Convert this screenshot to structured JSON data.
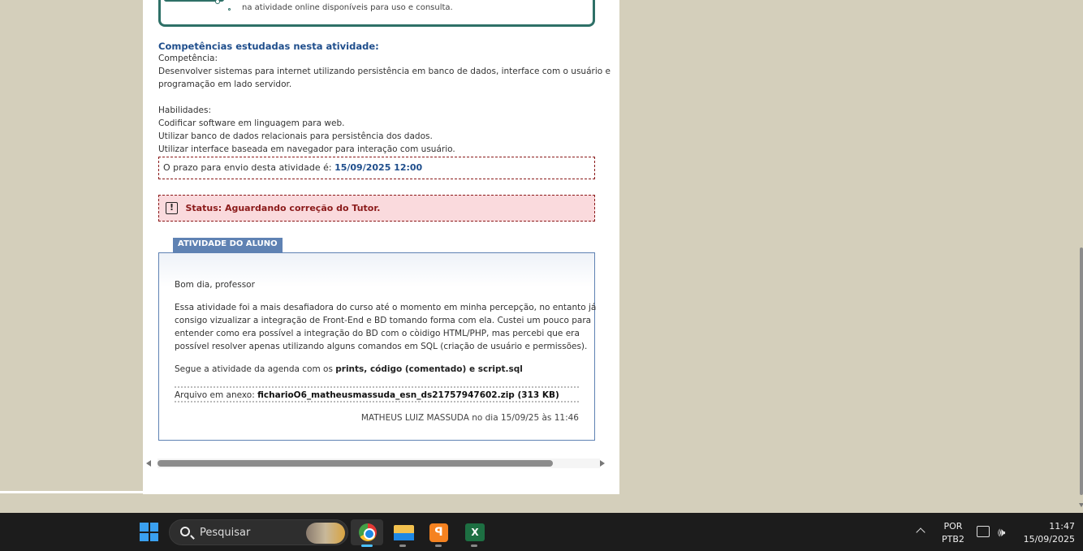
{
  "top_box": {
    "text": "na atividade online disponíveis para uso e consulta."
  },
  "competencias": {
    "title": "Competências estudadas nesta atividade:",
    "lines": [
      "Competência:",
      "Desenvolver sistemas para internet utilizando persistência em banco de dados, interface com o usuário e",
      "programação em lado servidor.",
      "",
      "Habilidades:",
      "Codificar software em linguagem para web.",
      "Utilizar banco de dados relacionais para persistência dos dados.",
      "Utilizar interface baseada em navegador para interação com usuário."
    ]
  },
  "deadline": {
    "label": "O prazo para envio desta atividade é:",
    "date": "15/09/2025 12:00"
  },
  "status": {
    "icon_char": "!",
    "text": "Status: Aguardando correção do Tutor."
  },
  "atividade": {
    "tab_label": "ATIVIDADE DO ALUNO",
    "greeting": "Bom dia, professor",
    "paragraph": [
      "Essa atividade foi a mais desafiadora do curso até o momento em minha percepção, no entanto já",
      "consigo vizualizar a integração de Front-End e BD tomando forma com ela. Custei um pouco para",
      "entender como era possível a integração do BD com o còidigo HTML/PHP, mas percebi que era",
      "possível resolver apenas utilizando alguns comandos em SQL (criação de usuário e permissões)."
    ],
    "segue_prefix": "Segue a atividade da agenda com os",
    "segue_bold": "prints, código (comentado) e script.sql",
    "attach_label": "Arquivo em anexo:",
    "attach_file": "ficharioO6_matheusmassuda_esn_ds21757947602.zip (313 KB)",
    "signature": "MATHEUS LUIZ MASSUDA no dia 15/09/25 às 11:46"
  },
  "taskbar": {
    "search_placeholder": "Pesquisar",
    "apps": [
      "chrome-icon",
      "file-explorer-icon",
      "xampp-icon",
      "excel-icon"
    ],
    "xampp_glyph": "ꟼ",
    "excel_glyph": "X",
    "lang_line1": "POR",
    "lang_line2": "PTB2",
    "time": "11:47",
    "date": "15/09/2025",
    "volume_glyph": "🕪",
    "accent": "#4cc2ff"
  }
}
